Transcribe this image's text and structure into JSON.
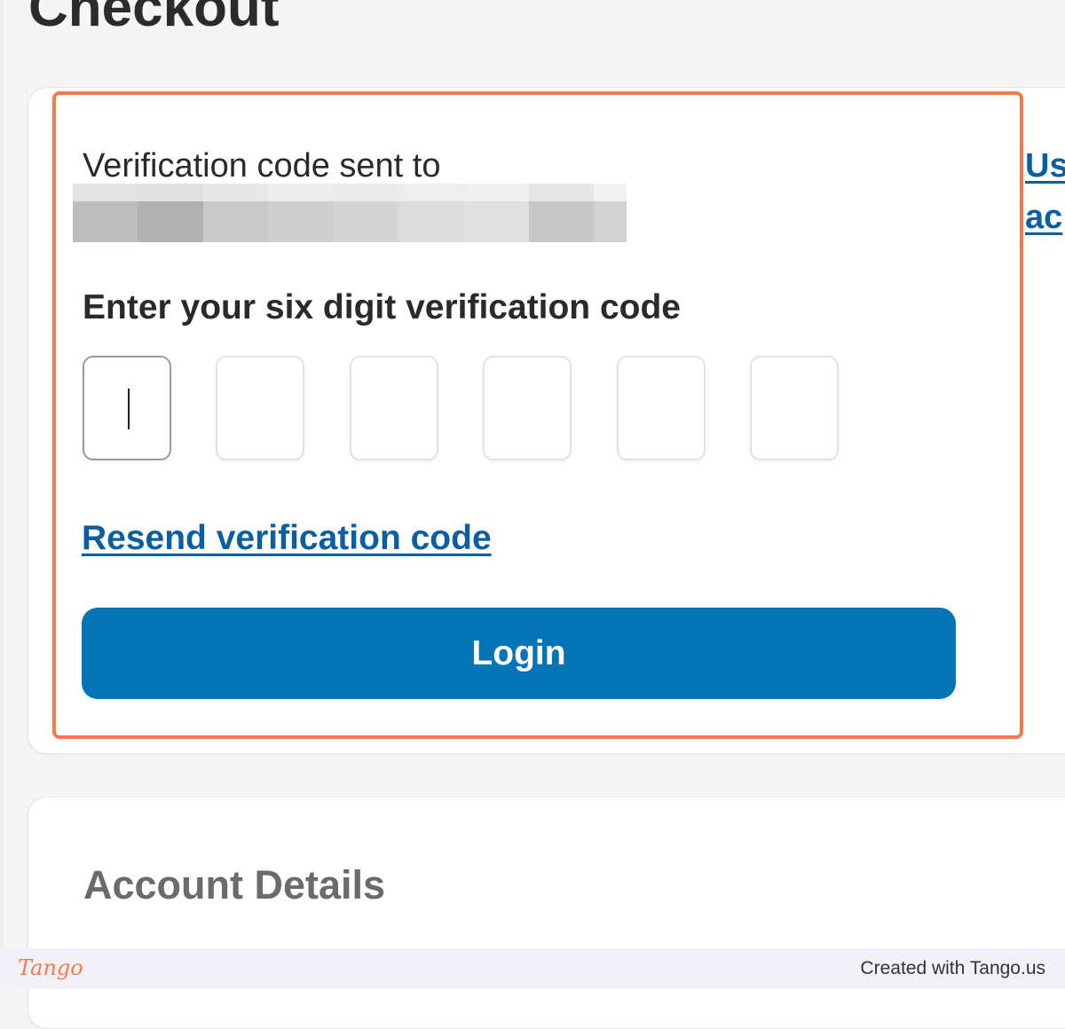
{
  "page": {
    "title": "Checkout"
  },
  "verification": {
    "sent_to_label": "Verification code sent to",
    "code_heading": "Enter your six digit verification code",
    "code_digits": [
      "",
      "",
      "",
      "",
      "",
      ""
    ],
    "active_digit_index": 0,
    "resend_link": "Resend verification code",
    "login_button": "Login"
  },
  "side_link": {
    "line1": "Us",
    "line2": "ac"
  },
  "account": {
    "heading": "Account Details"
  },
  "footer": {
    "logo_text": "Tango",
    "credit": "Created with Tango.us"
  },
  "colors": {
    "primary_button": "#0675b8",
    "link": "#0a5fa3",
    "highlight_border": "#f47a4a",
    "logo": "#f07c4f"
  }
}
